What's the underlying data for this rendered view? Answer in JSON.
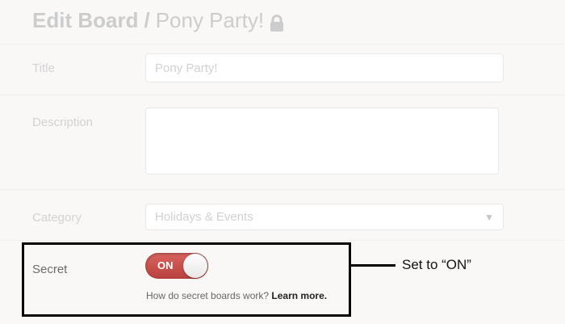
{
  "header": {
    "edit_label": "Edit Board",
    "separator": "/",
    "board_name": "Pony Party!",
    "lock_icon": "lock-icon"
  },
  "form": {
    "title_label": "Title",
    "title_value": "Pony Party!",
    "description_label": "Description",
    "description_value": "",
    "category_label": "Category",
    "category_value": "Holidays & Events",
    "category_caret": "▼",
    "secret_label": "Secret",
    "secret_toggle_state": "ON",
    "help_text": "How do secret boards work?",
    "help_link": "Learn more."
  },
  "annotation": {
    "callout_text": "Set to “ON”"
  },
  "colors": {
    "toggle_on": "#c54c48",
    "background": "#f4f3f2",
    "annotation": "#000000"
  }
}
